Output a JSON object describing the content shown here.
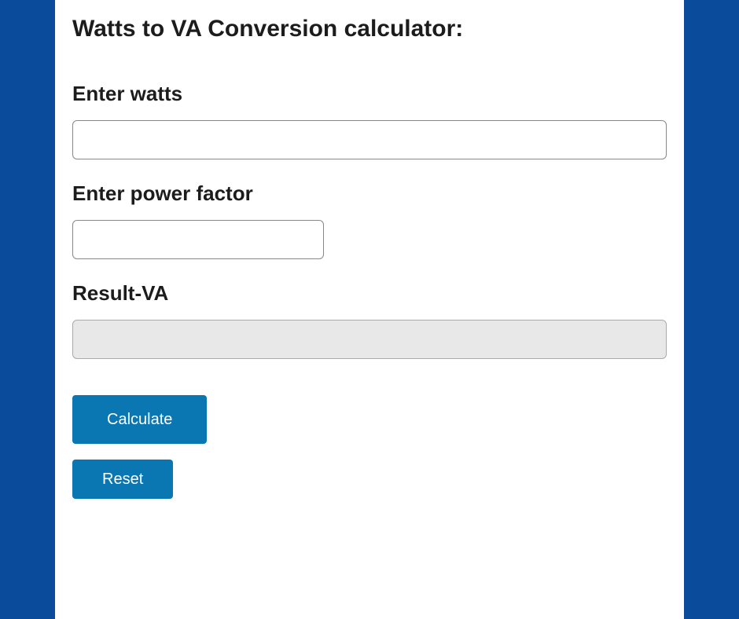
{
  "title": "Watts to VA Conversion calculator:",
  "fields": {
    "watts": {
      "label": "Enter watts",
      "value": ""
    },
    "power_factor": {
      "label": "Enter power factor",
      "value": ""
    },
    "result": {
      "label": "Result-VA",
      "value": ""
    }
  },
  "buttons": {
    "calculate": "Calculate",
    "reset": "Reset"
  },
  "colors": {
    "page_bg": "#0a4b9c",
    "button_bg": "#0a77b3",
    "result_bg": "#e8e8e8"
  }
}
